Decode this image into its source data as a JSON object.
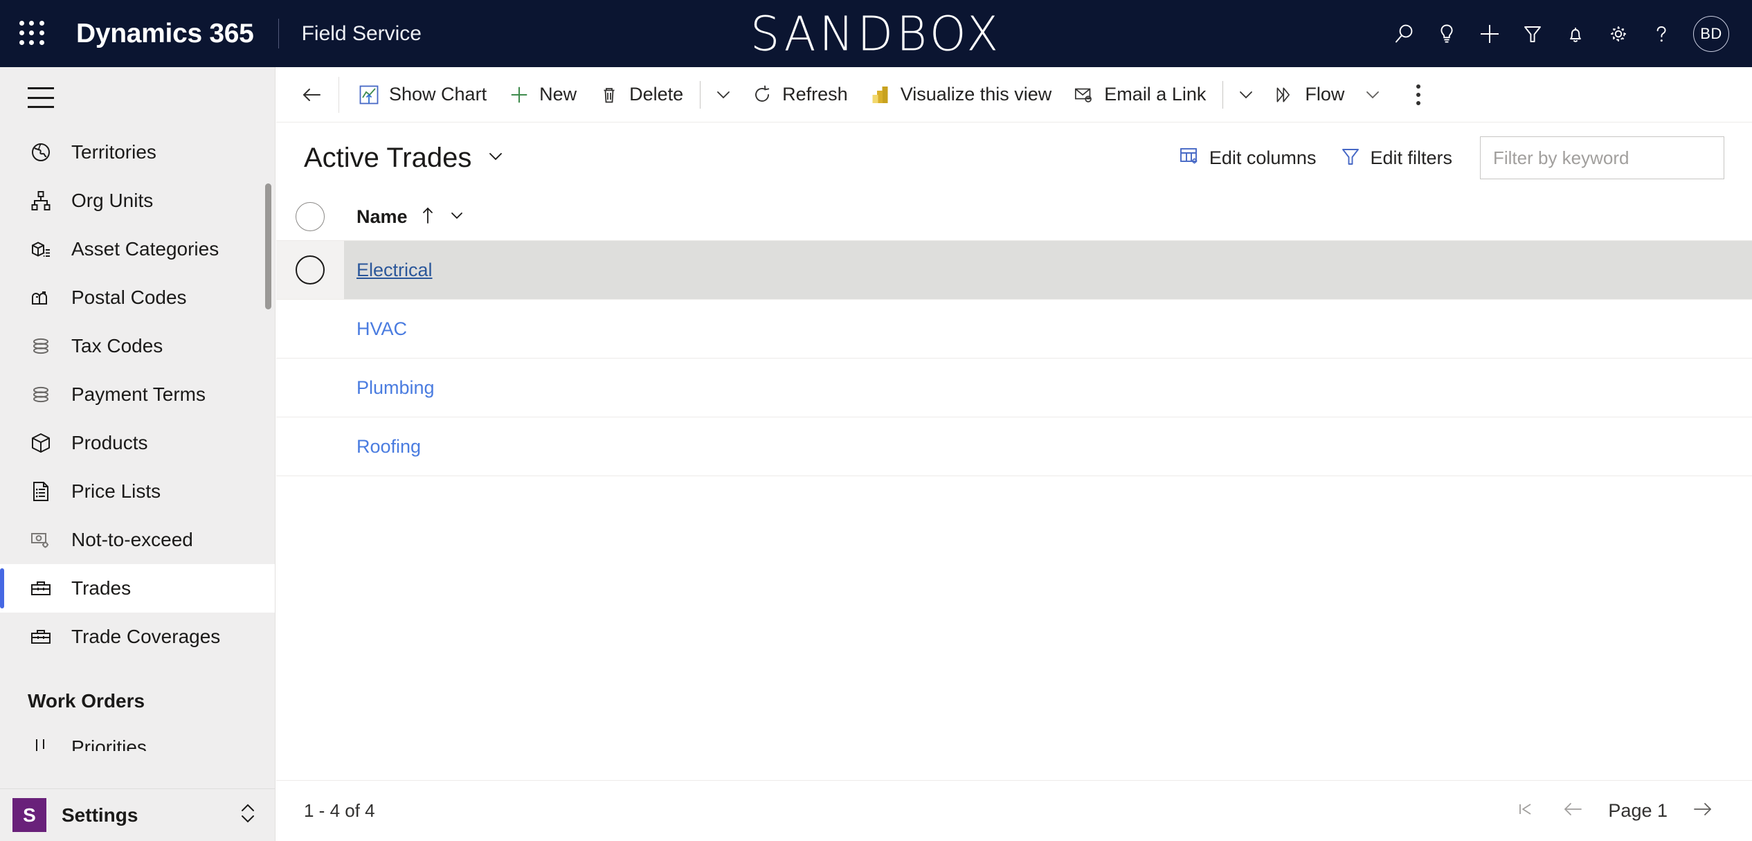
{
  "app_bar": {
    "waffle_icon": "waffle-grid-icon",
    "brand": "Dynamics 365",
    "app_name": "Field Service",
    "environment_banner": "SANDBOX",
    "actions": [
      {
        "name": "search-icon",
        "label": "Search"
      },
      {
        "name": "lightbulb-icon",
        "label": "Insights"
      },
      {
        "name": "plus-icon",
        "label": "Quick create"
      },
      {
        "name": "filter-funnel-icon",
        "label": "Filter"
      },
      {
        "name": "bell-icon",
        "label": "Notifications"
      },
      {
        "name": "gear-icon",
        "label": "Settings"
      },
      {
        "name": "question-mark-icon",
        "label": "Help"
      }
    ],
    "avatar_initials": "BD",
    "colors": {
      "background": "#0b1531",
      "text": "#ffffff",
      "divider": "#52597a"
    }
  },
  "sidebar": {
    "hamburger_icon": "hamburger-menu-icon",
    "items": [
      {
        "label": "Territories",
        "icon": "globe-icon",
        "selected": false
      },
      {
        "label": "Org Units",
        "icon": "org-chart-icon",
        "selected": false
      },
      {
        "label": "Asset Categories",
        "icon": "asset-box-icon",
        "selected": false
      },
      {
        "label": "Postal Codes",
        "icon": "mailbox-icon",
        "selected": false
      },
      {
        "label": "Tax Codes",
        "icon": "coin-stack-icon",
        "selected": false
      },
      {
        "label": "Payment Terms",
        "icon": "coin-stack-icon",
        "selected": false
      },
      {
        "label": "Products",
        "icon": "product-box-icon",
        "selected": false
      },
      {
        "label": "Price Lists",
        "icon": "price-list-icon",
        "selected": false
      },
      {
        "label": "Not-to-exceed",
        "icon": "money-gear-icon",
        "selected": false
      },
      {
        "label": "Trades",
        "icon": "toolbox-icon",
        "selected": true
      },
      {
        "label": "Trade Coverages",
        "icon": "toolbox-icon",
        "selected": false
      }
    ],
    "group_title": "Work Orders",
    "group_items": [
      {
        "label": "Priorities",
        "icon": "priority-sort-icon",
        "selected": false
      }
    ],
    "footer": {
      "area_initial": "S",
      "area_label": "Settings",
      "switcher_icon": "up-down-chevron-icon",
      "tile_color": "#69217a"
    },
    "accent_color": "#4668e3"
  },
  "command_bar": {
    "back_icon": "back-arrow-icon",
    "buttons": [
      {
        "label": "Show Chart",
        "icon": "show-chart-icon"
      },
      {
        "label": "New",
        "icon": "plus-green-icon"
      },
      {
        "label": "Delete",
        "icon": "trash-can-icon"
      },
      {
        "label": "Refresh",
        "icon": "refresh-circular-arrow-icon"
      },
      {
        "label": "Visualize this view",
        "icon": "power-bi-bars-icon"
      },
      {
        "label": "Email a Link",
        "icon": "email-link-icon"
      },
      {
        "label": "Flow",
        "icon": "power-automate-flow-icon"
      }
    ],
    "chevron_icon": "chevron-down-icon",
    "overflow_icon": "more-commands-ellipsis-icon"
  },
  "view_header": {
    "title": "Active Trades",
    "view_chevron_icon": "chevron-down-icon",
    "edit_columns_label": "Edit columns",
    "edit_columns_icon": "edit-columns-icon",
    "edit_filters_label": "Edit filters",
    "edit_filters_icon": "edit-filters-funnel-icon",
    "keyword_placeholder": "Filter by keyword",
    "keyword_value": ""
  },
  "grid": {
    "select_all_icon": "select-all-circle-icon",
    "columns": [
      {
        "label": "Name",
        "sort": "ascending",
        "sort_icon": "up-arrow-icon",
        "menu_icon": "chevron-down-icon"
      }
    ],
    "rows": [
      {
        "name": "Electrical",
        "selected": true
      },
      {
        "name": "HVAC",
        "selected": false
      },
      {
        "name": "Plumbing",
        "selected": false
      },
      {
        "name": "Roofing",
        "selected": false
      }
    ],
    "link_color": "#4a7ce0",
    "selected_link_color": "#2b579a",
    "selected_row_color": "#dededc"
  },
  "footer": {
    "record_count": "1 - 4 of 4",
    "first_page_icon": "first-page-icon",
    "prev_page_icon": "previous-page-arrow-icon",
    "page_label": "Page 1",
    "next_page_icon": "next-page-arrow-icon"
  }
}
